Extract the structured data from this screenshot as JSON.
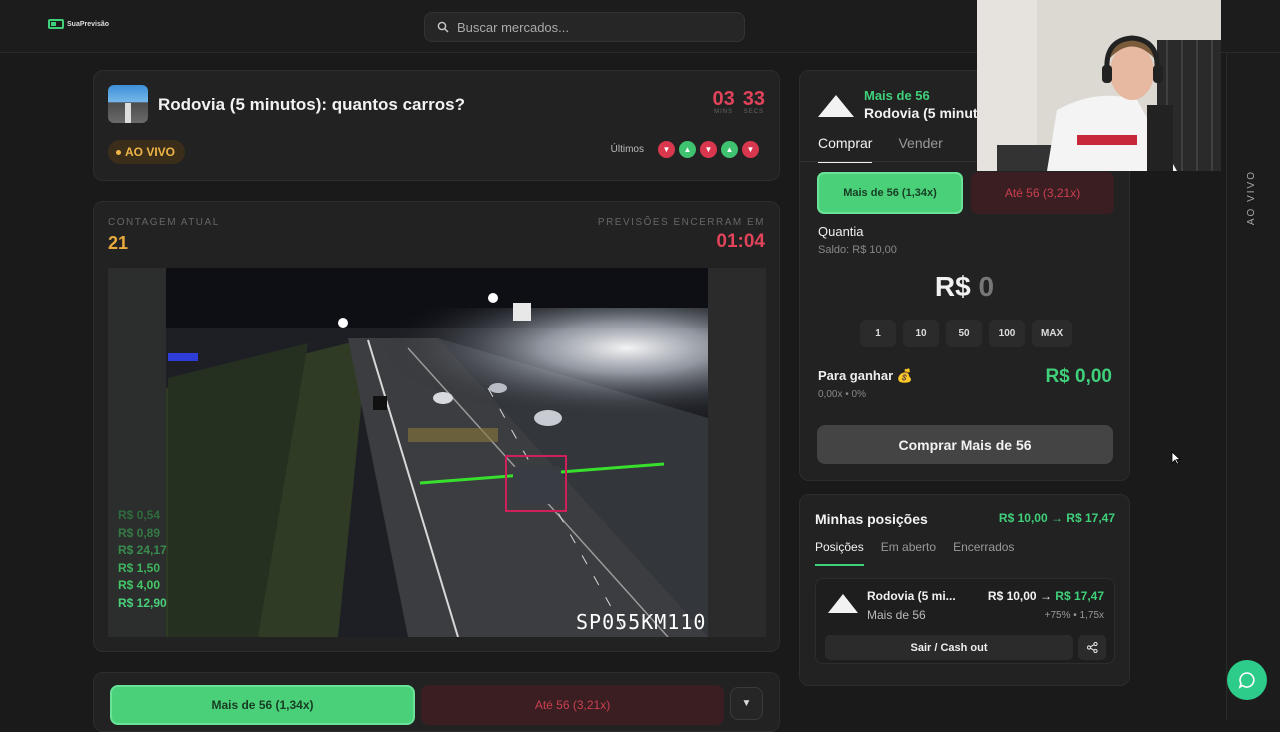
{
  "header": {
    "logo_text": "SuaPrevisão",
    "search_placeholder": "Buscar mercados..."
  },
  "market": {
    "title": "Rodovia (5 minutos): quantos carros?",
    "timer": {
      "mins": "03",
      "mins_label": "MINS",
      "secs": "33",
      "secs_label": "SECS"
    },
    "status": "AO VIVO",
    "history_label": "Últimos",
    "history": [
      "down",
      "up",
      "down",
      "up",
      "down"
    ]
  },
  "live": {
    "count_label": "CONTAGEM ATUAL",
    "count_value": "21",
    "ends_label": "PREVISÕES ENCERRAM EM",
    "ends_value": "01:04",
    "camera_id": "SP055KM110",
    "bet_feed": [
      {
        "text": "R$ 0,54",
        "color": "#2f6b3e"
      },
      {
        "text": "R$ 0,89",
        "color": "#357a45"
      },
      {
        "text": "R$ 24,17",
        "color": "#3a8c4d"
      },
      {
        "text": "R$ 1,50",
        "color": "#3fb35e"
      },
      {
        "text": "R$ 4,00",
        "color": "#45c767"
      },
      {
        "text": "R$ 12,90",
        "color": "#4bd07a"
      }
    ]
  },
  "bottom_bar": {
    "yes_label": "Mais de 56 (1,34x)",
    "no_label": "Até 56 (3,21x)"
  },
  "trade": {
    "outcome": "Mais de 56",
    "market_short": "Rodovia (5 minutos)",
    "tabs": [
      "Comprar",
      "Vender"
    ],
    "yes_option": "Mais de 56 (1,34x)",
    "no_option": "Até 56 (3,21x)",
    "qty_label": "Quantia",
    "balance": "Saldo: R$ 10,00",
    "amount_currency": "R$",
    "amount_value": "0",
    "quick_amounts": [
      "1",
      "10",
      "50",
      "100",
      "MAX"
    ],
    "win_label": "Para ganhar 💰",
    "win_sub": "0,00x • 0%",
    "win_value": "R$ 0,00",
    "buy_label": "Comprar Mais de 56"
  },
  "positions": {
    "title": "Minhas posições",
    "total": "R$ 10,00 → R$ 17,47",
    "tabs": [
      "Posições",
      "Em aberto",
      "Encerrados"
    ],
    "item": {
      "name": "Rodovia (5 mi...",
      "outcome": "Mais de 56",
      "from": "R$ 10,00 →",
      "to": "R$ 17,47",
      "change": "+75% • 1,75x",
      "cashout_label": "Sair / Cash out"
    }
  },
  "sidebar": {
    "live_label": "AO VIVO"
  },
  "colors": {
    "accent_green": "#4bd07a",
    "accent_red": "#e0435a",
    "live_amber": "#f0b547"
  }
}
